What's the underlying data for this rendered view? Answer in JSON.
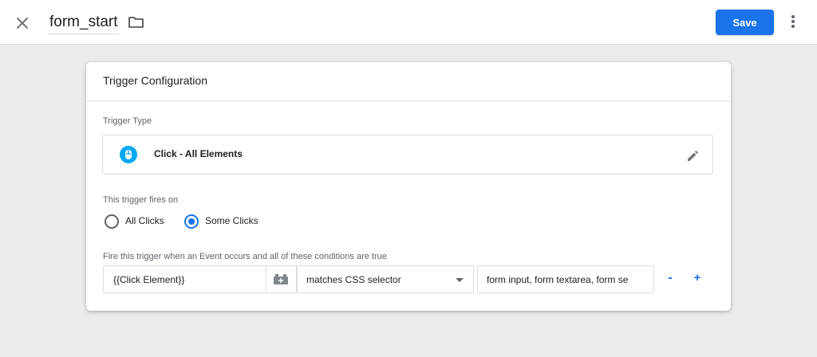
{
  "header": {
    "tag_name": "form_start",
    "save_label": "Save"
  },
  "card": {
    "title": "Trigger Configuration",
    "trigger_type_label": "Trigger Type",
    "trigger_type_name": "Click - All Elements",
    "fires_on_label": "This trigger fires on",
    "options": [
      {
        "label": "All Clicks",
        "checked": false
      },
      {
        "label": "Some Clicks",
        "checked": true
      }
    ],
    "conditions_label": "Fire this trigger when an Event occurs and all of these conditions are true",
    "condition": {
      "variable": "{{Click Element}}",
      "operator": "matches CSS selector",
      "value": "form input, form textarea, form se"
    },
    "remove_label": "-",
    "add_label": "+"
  },
  "colors": {
    "accent": "#1a73e8",
    "trigger_icon": "#03a9f4",
    "background": "#ececec"
  },
  "icons": [
    "close-icon",
    "folder-icon",
    "more-vert-icon",
    "mouse-icon",
    "edit-icon",
    "variable-picker-icon"
  ]
}
